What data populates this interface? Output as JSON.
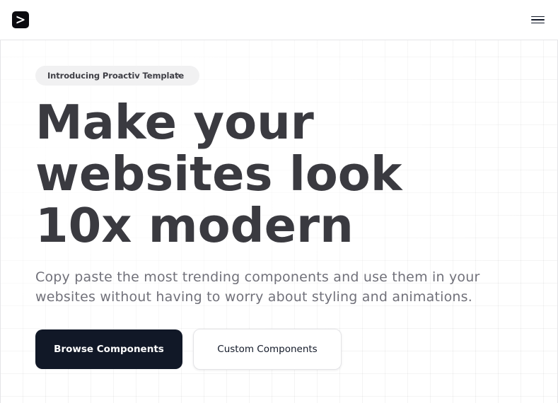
{
  "brand": {
    "logo_icon": "play-chevron-logo-icon"
  },
  "nav": {
    "menu_icon": "hamburger-menu-icon"
  },
  "announcement": {
    "label": "Introducing Proactiv Template",
    "icon": "chevron-right-icon",
    "chevron": "›"
  },
  "hero": {
    "headline_lines": [
      "Make your",
      "websites look",
      "10x modern"
    ],
    "subtitle_lines": [
      "Copy paste the most trending components and use them in your",
      "websites without having to worry about styling and animations."
    ]
  },
  "cta": {
    "primary_label": "Browse Components",
    "secondary_label": "Custom Components"
  },
  "colors": {
    "primary_button": "#111827",
    "headline": "#3a3a40",
    "subtitle": "#71717a"
  }
}
